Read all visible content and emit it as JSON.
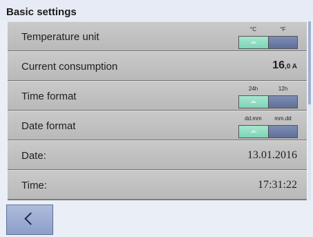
{
  "header": {
    "title": "Basic settings"
  },
  "rows": {
    "temperature_unit": {
      "label": "Temperature unit",
      "options": [
        "°C",
        "°F"
      ],
      "selected": "°C"
    },
    "current_consumption": {
      "label": "Current consumption",
      "value_main": "16",
      "value_small": ",0 A"
    },
    "time_format": {
      "label": "Time format",
      "options": [
        "24h",
        "12h"
      ],
      "selected": "24h"
    },
    "date_format": {
      "label": "Date format",
      "options": [
        "dd.mm",
        "mm.dd"
      ],
      "selected": "dd.mm"
    },
    "date": {
      "label": "Date:",
      "value": "13.01.2016"
    },
    "time": {
      "label": "Time:",
      "value": "17:31:22"
    }
  },
  "colors": {
    "toggle_on": "#8ddcbf",
    "toggle_off": "#6f7fa7",
    "back_button": "#9fb0d6"
  },
  "icons": {
    "back": "chevron-left-icon"
  }
}
